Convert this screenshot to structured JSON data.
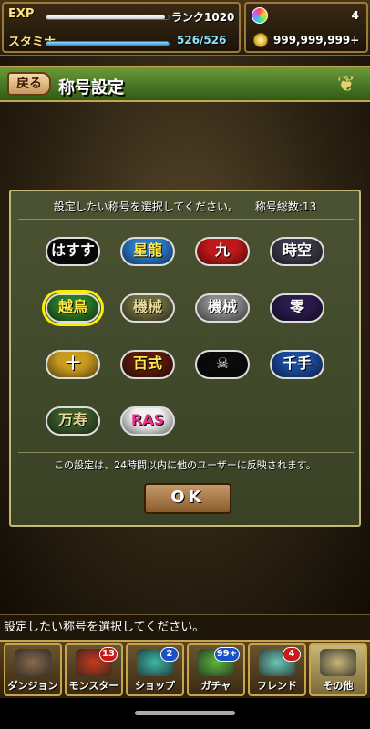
{
  "status": {
    "exp_label": "EXP",
    "rank": "ランク1020",
    "exp_progress": 0.97,
    "stamina_label": "スタミナ",
    "stamina": "526/526",
    "stamina_progress": 1.0,
    "stones": "4",
    "coins": "999,999,999+"
  },
  "header": {
    "back_label": "戻る",
    "title": "称号設定"
  },
  "dialog": {
    "prompt": "設定したい称号を選択してください。",
    "total": "称号総数:13",
    "badges": [
      {
        "label": "はすす",
        "bg": "#0a0a0a",
        "color": "#ffffff"
      },
      {
        "label": "星龍",
        "bg": "#2a78c8",
        "color": "#ffe84a"
      },
      {
        "label": "九",
        "bg": "#c01818",
        "color": "#ffffff"
      },
      {
        "label": "時空",
        "bg": "#3a3a4a",
        "color": "#ffffff"
      },
      {
        "label": "越鳥",
        "bg": "#2a7a2a",
        "color": "#ffe84a"
      },
      {
        "label": "機械",
        "bg": "#6a6a40",
        "color": "#e8d89a"
      },
      {
        "label": "機械",
        "bg": "#8a8a8a",
        "color": "#ffffff"
      },
      {
        "label": "零",
        "bg": "#2a1a4a",
        "color": "#ffffff"
      },
      {
        "label": "十",
        "bg": "#c89a20",
        "color": "#ffffff"
      },
      {
        "label": "百式",
        "bg": "#5a1a0a",
        "color": "#ffe84a"
      },
      {
        "label": "☠",
        "bg": "#0a0a0a",
        "color": "#ffffff"
      },
      {
        "label": "千手",
        "bg": "#1a4a9a",
        "color": "#ffffff"
      },
      {
        "label": "万寿",
        "bg": "#3a5a2a",
        "color": "#e8d89a"
      },
      {
        "label": "RAS",
        "bg": "#f2f2f2",
        "color": "#e8308a"
      }
    ],
    "note": "この設定は、24時間以内に他のユーザーに反映されます。",
    "ok_label": "OK"
  },
  "ticker": "設定したい称号を選択してください。",
  "nav": [
    {
      "label": "ダンジョン",
      "icon": "dungeon-gate-icon",
      "color": "#8a6a4a",
      "badge": ""
    },
    {
      "label": "モンスター",
      "icon": "monster-icon",
      "color": "#c83a1a",
      "badge": "13"
    },
    {
      "label": "ショップ",
      "icon": "shop-stone-icon",
      "color": "#3ab8a8",
      "badge": "2"
    },
    {
      "label": "ガチャ",
      "icon": "gacha-egg-icon",
      "color": "#5ab83a",
      "badge": "99+"
    },
    {
      "label": "フレンド",
      "icon": "friend-icon",
      "color": "#6ac8b8",
      "badge": "4"
    },
    {
      "label": "その他",
      "icon": "other-icon",
      "color": "#c8b878",
      "badge": ""
    }
  ]
}
